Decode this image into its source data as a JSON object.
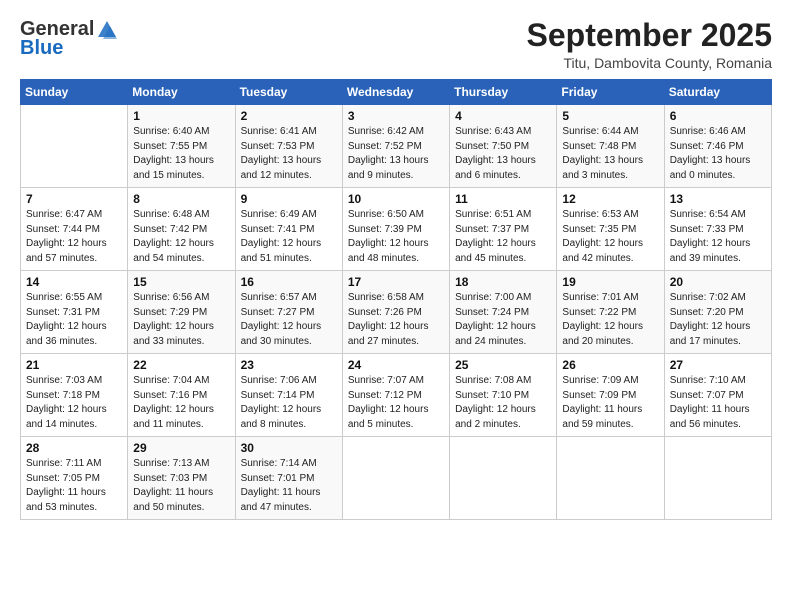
{
  "header": {
    "logo_general": "General",
    "logo_blue": "Blue",
    "month_title": "September 2025",
    "location": "Titu, Dambovita County, Romania"
  },
  "days_of_week": [
    "Sunday",
    "Monday",
    "Tuesday",
    "Wednesday",
    "Thursday",
    "Friday",
    "Saturday"
  ],
  "weeks": [
    [
      {
        "day": "",
        "sunrise": "",
        "sunset": "",
        "daylight": ""
      },
      {
        "day": "1",
        "sunrise": "Sunrise: 6:40 AM",
        "sunset": "Sunset: 7:55 PM",
        "daylight": "Daylight: 13 hours and 15 minutes."
      },
      {
        "day": "2",
        "sunrise": "Sunrise: 6:41 AM",
        "sunset": "Sunset: 7:53 PM",
        "daylight": "Daylight: 13 hours and 12 minutes."
      },
      {
        "day": "3",
        "sunrise": "Sunrise: 6:42 AM",
        "sunset": "Sunset: 7:52 PM",
        "daylight": "Daylight: 13 hours and 9 minutes."
      },
      {
        "day": "4",
        "sunrise": "Sunrise: 6:43 AM",
        "sunset": "Sunset: 7:50 PM",
        "daylight": "Daylight: 13 hours and 6 minutes."
      },
      {
        "day": "5",
        "sunrise": "Sunrise: 6:44 AM",
        "sunset": "Sunset: 7:48 PM",
        "daylight": "Daylight: 13 hours and 3 minutes."
      },
      {
        "day": "6",
        "sunrise": "Sunrise: 6:46 AM",
        "sunset": "Sunset: 7:46 PM",
        "daylight": "Daylight: 13 hours and 0 minutes."
      }
    ],
    [
      {
        "day": "7",
        "sunrise": "Sunrise: 6:47 AM",
        "sunset": "Sunset: 7:44 PM",
        "daylight": "Daylight: 12 hours and 57 minutes."
      },
      {
        "day": "8",
        "sunrise": "Sunrise: 6:48 AM",
        "sunset": "Sunset: 7:42 PM",
        "daylight": "Daylight: 12 hours and 54 minutes."
      },
      {
        "day": "9",
        "sunrise": "Sunrise: 6:49 AM",
        "sunset": "Sunset: 7:41 PM",
        "daylight": "Daylight: 12 hours and 51 minutes."
      },
      {
        "day": "10",
        "sunrise": "Sunrise: 6:50 AM",
        "sunset": "Sunset: 7:39 PM",
        "daylight": "Daylight: 12 hours and 48 minutes."
      },
      {
        "day": "11",
        "sunrise": "Sunrise: 6:51 AM",
        "sunset": "Sunset: 7:37 PM",
        "daylight": "Daylight: 12 hours and 45 minutes."
      },
      {
        "day": "12",
        "sunrise": "Sunrise: 6:53 AM",
        "sunset": "Sunset: 7:35 PM",
        "daylight": "Daylight: 12 hours and 42 minutes."
      },
      {
        "day": "13",
        "sunrise": "Sunrise: 6:54 AM",
        "sunset": "Sunset: 7:33 PM",
        "daylight": "Daylight: 12 hours and 39 minutes."
      }
    ],
    [
      {
        "day": "14",
        "sunrise": "Sunrise: 6:55 AM",
        "sunset": "Sunset: 7:31 PM",
        "daylight": "Daylight: 12 hours and 36 minutes."
      },
      {
        "day": "15",
        "sunrise": "Sunrise: 6:56 AM",
        "sunset": "Sunset: 7:29 PM",
        "daylight": "Daylight: 12 hours and 33 minutes."
      },
      {
        "day": "16",
        "sunrise": "Sunrise: 6:57 AM",
        "sunset": "Sunset: 7:27 PM",
        "daylight": "Daylight: 12 hours and 30 minutes."
      },
      {
        "day": "17",
        "sunrise": "Sunrise: 6:58 AM",
        "sunset": "Sunset: 7:26 PM",
        "daylight": "Daylight: 12 hours and 27 minutes."
      },
      {
        "day": "18",
        "sunrise": "Sunrise: 7:00 AM",
        "sunset": "Sunset: 7:24 PM",
        "daylight": "Daylight: 12 hours and 24 minutes."
      },
      {
        "day": "19",
        "sunrise": "Sunrise: 7:01 AM",
        "sunset": "Sunset: 7:22 PM",
        "daylight": "Daylight: 12 hours and 20 minutes."
      },
      {
        "day": "20",
        "sunrise": "Sunrise: 7:02 AM",
        "sunset": "Sunset: 7:20 PM",
        "daylight": "Daylight: 12 hours and 17 minutes."
      }
    ],
    [
      {
        "day": "21",
        "sunrise": "Sunrise: 7:03 AM",
        "sunset": "Sunset: 7:18 PM",
        "daylight": "Daylight: 12 hours and 14 minutes."
      },
      {
        "day": "22",
        "sunrise": "Sunrise: 7:04 AM",
        "sunset": "Sunset: 7:16 PM",
        "daylight": "Daylight: 12 hours and 11 minutes."
      },
      {
        "day": "23",
        "sunrise": "Sunrise: 7:06 AM",
        "sunset": "Sunset: 7:14 PM",
        "daylight": "Daylight: 12 hours and 8 minutes."
      },
      {
        "day": "24",
        "sunrise": "Sunrise: 7:07 AM",
        "sunset": "Sunset: 7:12 PM",
        "daylight": "Daylight: 12 hours and 5 minutes."
      },
      {
        "day": "25",
        "sunrise": "Sunrise: 7:08 AM",
        "sunset": "Sunset: 7:10 PM",
        "daylight": "Daylight: 12 hours and 2 minutes."
      },
      {
        "day": "26",
        "sunrise": "Sunrise: 7:09 AM",
        "sunset": "Sunset: 7:09 PM",
        "daylight": "Daylight: 11 hours and 59 minutes."
      },
      {
        "day": "27",
        "sunrise": "Sunrise: 7:10 AM",
        "sunset": "Sunset: 7:07 PM",
        "daylight": "Daylight: 11 hours and 56 minutes."
      }
    ],
    [
      {
        "day": "28",
        "sunrise": "Sunrise: 7:11 AM",
        "sunset": "Sunset: 7:05 PM",
        "daylight": "Daylight: 11 hours and 53 minutes."
      },
      {
        "day": "29",
        "sunrise": "Sunrise: 7:13 AM",
        "sunset": "Sunset: 7:03 PM",
        "daylight": "Daylight: 11 hours and 50 minutes."
      },
      {
        "day": "30",
        "sunrise": "Sunrise: 7:14 AM",
        "sunset": "Sunset: 7:01 PM",
        "daylight": "Daylight: 11 hours and 47 minutes."
      },
      {
        "day": "",
        "sunrise": "",
        "sunset": "",
        "daylight": ""
      },
      {
        "day": "",
        "sunrise": "",
        "sunset": "",
        "daylight": ""
      },
      {
        "day": "",
        "sunrise": "",
        "sunset": "",
        "daylight": ""
      },
      {
        "day": "",
        "sunrise": "",
        "sunset": "",
        "daylight": ""
      }
    ]
  ]
}
